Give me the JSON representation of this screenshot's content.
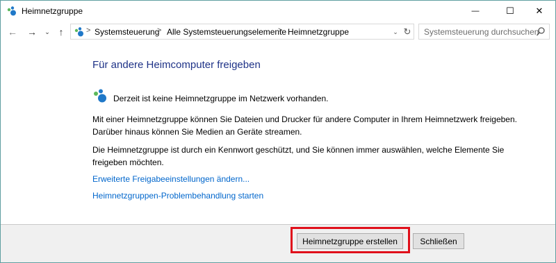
{
  "window": {
    "title": "Heimnetzgruppe",
    "controls": {
      "minimize": "—",
      "maximize": "☐",
      "close": "✕"
    }
  },
  "nav": {
    "back": "←",
    "forward": "→",
    "recent": "⌄",
    "up": "↑"
  },
  "address": {
    "breadcrumbs": [
      "Systemsteuerung",
      "Alle Systemsteuerungselemente",
      "Heimnetzgruppe"
    ],
    "separator": ">",
    "dropdown": "⌄",
    "refresh": "↻"
  },
  "search": {
    "placeholder": "Systemsteuerung durchsuchen"
  },
  "main": {
    "heading": "Für andere Heimcomputer freigeben",
    "status_text": "Derzeit ist keine Heimnetzgruppe im Netzwerk vorhanden.",
    "paragraph1": "Mit einer Heimnetzgruppe können Sie Dateien und Drucker für andere Computer in Ihrem Heimnetzwerk freigeben. Darüber hinaus können Sie Medien an Geräte streamen.",
    "paragraph2": "Die Heimnetzgruppe ist durch ein Kennwort geschützt, und Sie können immer auswählen, welche Elemente Sie freigeben möchten.",
    "link_advanced": "Erweiterte Freigabeeinstellungen ändern...",
    "link_troubleshoot": "Heimnetzgruppen-Problembehandlung starten"
  },
  "footer": {
    "create_button": "Heimnetzgruppe erstellen",
    "close_button": "Schließen"
  },
  "colors": {
    "heading": "#1e3287",
    "link": "#0066cc",
    "highlight": "#e0101b",
    "homegroup_blue": "#1f78c8",
    "homegroup_green": "#5cb85c"
  },
  "icons": {
    "title": "homegroup-icon",
    "address": "homegroup-icon",
    "status": "homegroup-icon",
    "search": "search-icon"
  }
}
